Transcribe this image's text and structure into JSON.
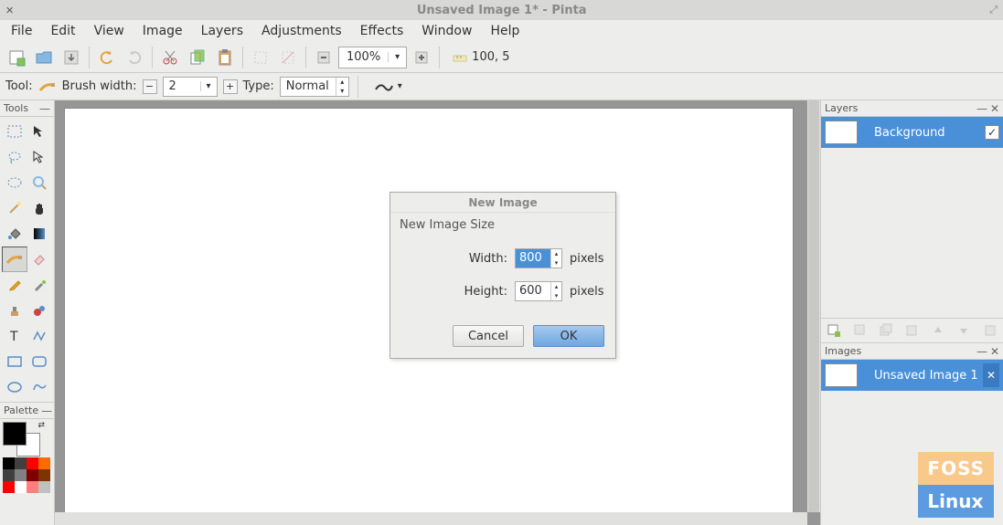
{
  "window": {
    "title": "Unsaved Image 1* - Pinta"
  },
  "menu": {
    "file": "File",
    "edit": "Edit",
    "view": "View",
    "image": "Image",
    "layers": "Layers",
    "adjustments": "Adjustments",
    "effects": "Effects",
    "window": "Window",
    "help": "Help"
  },
  "toolbar": {
    "zoom_value": "100%",
    "coord": "100, 5"
  },
  "options": {
    "tool_label": "Tool:",
    "brush_width_label": "Brush width:",
    "brush_width_value": "2",
    "type_label": "Type:",
    "type_value": "Normal"
  },
  "panels": {
    "tools_title": "Tools",
    "palette_title": "Palette",
    "layers_title": "Layers",
    "images_title": "Images"
  },
  "layers": {
    "items": [
      {
        "name": "Background",
        "visible": true
      }
    ]
  },
  "images": {
    "items": [
      {
        "name": "Unsaved Image 1"
      }
    ]
  },
  "dialog": {
    "title": "New Image",
    "subtitle": "New Image Size",
    "width_label": "Width:",
    "height_label": "Height:",
    "width_value": "800",
    "height_value": "600",
    "unit": "pixels",
    "cancel": "Cancel",
    "ok": "OK"
  },
  "palette_colors": {
    "fg": "#000000",
    "bg": "#ffffff",
    "row1": [
      "#000000",
      "#404040",
      "#808080",
      "#c0c0c0"
    ],
    "row2": [
      "#202020",
      "#606060",
      "#a0a0a0",
      "#e0e0e0"
    ],
    "row3": [
      "#800000",
      "#ff0000",
      "#ff4040",
      "#ff8080"
    ]
  },
  "watermark": {
    "top": "FOSS",
    "bottom": "Linux"
  }
}
